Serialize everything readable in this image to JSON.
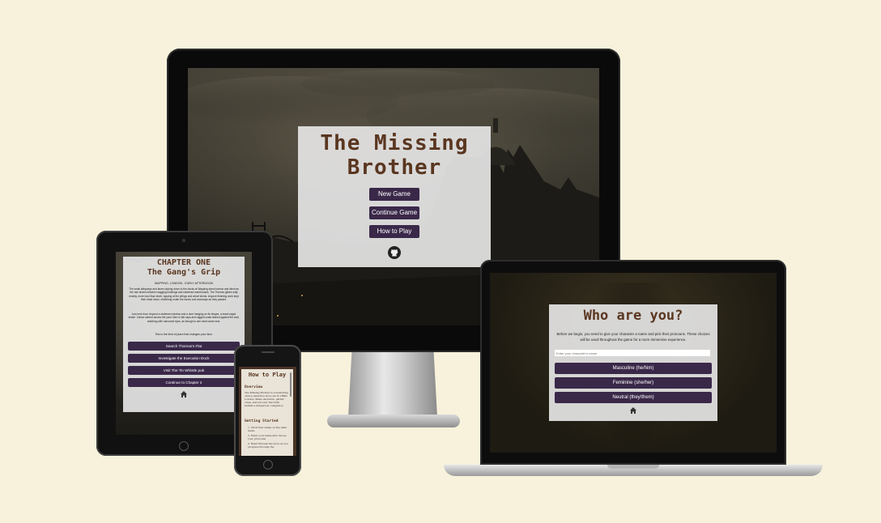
{
  "desktop": {
    "title_line1": "The Missing",
    "title_line2": "Brother",
    "buttons": [
      "New Game",
      "Continue Game",
      "How to Play"
    ],
    "github_icon": "github-icon"
  },
  "tablet": {
    "chapter_label": "CHAPTER ONE",
    "chapter_title": "The Gang's Grip",
    "location": "WAPPING, LONDON - EARLY AFTERNOON",
    "para1": "The small alleyways and lanes sloping down to the docks at Wapping stand narrow and silent as the rain drums between sagging buildings and shuttered warehouses. The Thames glides dully nearby, more mud than silver, lapping at the pilings and wharf sheds. Anyone finishing work kept their head down, sheltering under the eaves and doorways as they passed.",
    "para2": "Just next door, beyond a shuttered window and a door hanging on its hinges, a brawl raged inside. Voices carried across the yard. Men in flat caps and ragged coats leaned against the wall, watching with narrowed eyes, as though to see what came next.",
    "para3": "This is the kind of place that changes your face.",
    "buttons": [
      "Search Thomas's Flat",
      "Investigate the Execution Dock",
      "Visit The Tin Whistle pub",
      "Continue to Chapter 2"
    ],
    "home_icon": "home-icon"
  },
  "phone": {
    "title": "How to Play",
    "overview_heading": "Overview",
    "overview_text": "The Missing Brother is a branching choice detective story set in 1890s London. Make decisions, gather clues, and uncover the truth behind a dangerous conspiracy.",
    "getting_started_heading": "Getting Started",
    "steps": [
      "Click New Game on the main menu",
      "Enter your name and choose your pronouns",
      "Read through the story as you progress through the"
    ]
  },
  "laptop": {
    "title": "Who are you?",
    "intro": "Before we begin, you need to give your character a name and pick their pronouns. These choices will be used throughout the game for a more immersive experience.",
    "name_placeholder": "Enter your character's name",
    "buttons": [
      "Masculine (he/him)",
      "Feminine (she/her)",
      "Neutral (they/them)"
    ],
    "home_icon": "home-icon"
  }
}
